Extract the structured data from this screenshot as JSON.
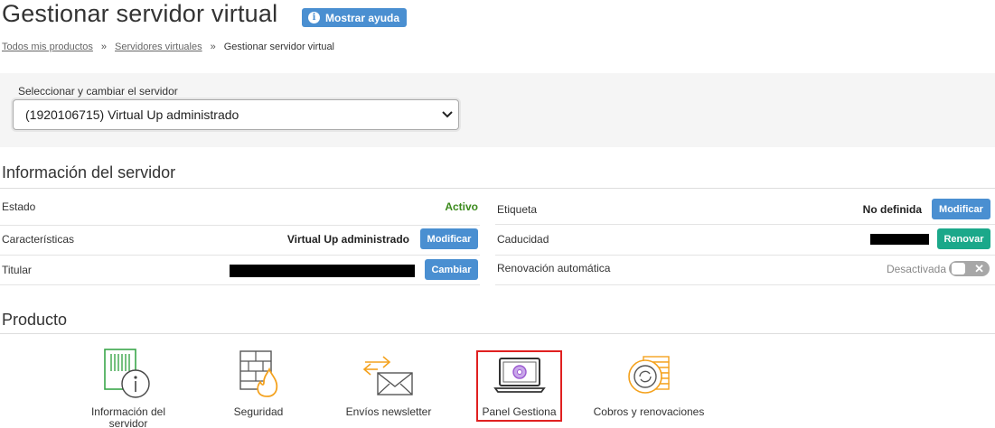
{
  "header": {
    "title": "Gestionar servidor virtual",
    "help_label": "Mostrar ayuda"
  },
  "breadcrumb": {
    "items": [
      "Todos mis productos",
      "Servidores virtuales",
      "Gestionar servidor virtual"
    ],
    "separator": "»"
  },
  "server_selector": {
    "label": "Seleccionar y cambiar el servidor",
    "selected": "(1920106715) Virtual Up administrado"
  },
  "server_info": {
    "title": "Información del servidor",
    "left": {
      "estado_label": "Estado",
      "estado_value": "Activo",
      "caracteristicas_label": "Características",
      "caracteristicas_value": "Virtual Up administrado",
      "caracteristicas_button": "Modificar",
      "titular_label": "Titular",
      "titular_button": "Cambiar"
    },
    "right": {
      "etiqueta_label": "Etiqueta",
      "etiqueta_value": "No definida",
      "etiqueta_button": "Modificar",
      "caducidad_label": "Caducidad",
      "caducidad_button": "Renovar",
      "renovacion_label": "Renovación automática",
      "renovacion_value": "Desactivada",
      "toggle_off_symbol": "✕"
    }
  },
  "product": {
    "title": "Producto",
    "items": [
      {
        "label": "Información del servidor",
        "icon": "server-info-icon"
      },
      {
        "label": "Seguridad",
        "icon": "firewall-icon"
      },
      {
        "label": "Envíos newsletter",
        "icon": "newsletter-icon"
      },
      {
        "label": "Panel Gestiona",
        "icon": "laptop-panel-icon"
      },
      {
        "label": "Cobros y renovaciones",
        "icon": "coins-icon"
      }
    ]
  },
  "colors": {
    "accent_blue": "#4a8fd1",
    "renew_green": "#1ba88a",
    "active_green": "#3b8a1c",
    "highlight_red": "#e02020",
    "icon_green": "#3aa64a",
    "icon_orange": "#f4a21e",
    "icon_purple": "#9b59d0"
  }
}
